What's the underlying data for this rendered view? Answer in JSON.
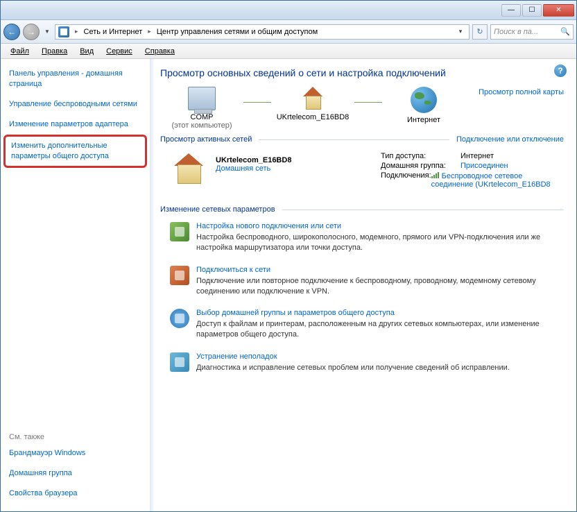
{
  "breadcrumb": {
    "level1": "Сеть и Интернет",
    "level2": "Центр управления сетями и общим доступом"
  },
  "search": {
    "placeholder": "Поиск в па..."
  },
  "menu": {
    "file": "Файл",
    "edit": "Правка",
    "view": "Вид",
    "tools": "Сервис",
    "help": "Справка"
  },
  "sidebar": {
    "home": "Панель управления - домашняя страница",
    "wireless": "Управление беспроводными сетями",
    "adapter": "Изменение параметров адаптера",
    "advanced": "Изменить дополнительные параметры общего доступа",
    "seealso_label": "См. также",
    "firewall": "Брандмауэр Windows",
    "homegroup": "Домашняя группа",
    "browser": "Свойства браузера"
  },
  "content": {
    "heading": "Просмотр основных сведений о сети и настройка подключений",
    "fullmap": "Просмотр полной карты",
    "map": {
      "node1": "COMP",
      "node1_sub": "(этот компьютер)",
      "node2": "UKrtelecom_E16BD8",
      "node3": "Интернет"
    },
    "active_label": "Просмотр активных сетей",
    "connect_link": "Подключение или отключение",
    "network": {
      "name": "UKrtelecom_E16BD8",
      "type": "Домашняя сеть",
      "prop_access_lbl": "Тип доступа:",
      "prop_access_val": "Интернет",
      "prop_homegroup_lbl": "Домашняя группа:",
      "prop_homegroup_val": "Присоединен",
      "prop_conn_lbl": "Подключения:",
      "prop_conn_val": "Беспроводное сетевое соединение (UKrtelecom_E16BD8"
    },
    "change_label": "Изменение сетевых параметров",
    "tasks": [
      {
        "title": "Настройка нового подключения или сети",
        "desc": "Настройка беспроводного, широкополосного, модемного, прямого или VPN-подключения или же настройка маршрутизатора или точки доступа."
      },
      {
        "title": "Подключиться к сети",
        "desc": "Подключение или повторное подключение к беспроводному, проводному, модемному сетевому соединению или подключение к VPN."
      },
      {
        "title": "Выбор домашней группы и параметров общего доступа",
        "desc": "Доступ к файлам и принтерам, расположенным на других сетевых компьютерах, или изменение параметров общего доступа."
      },
      {
        "title": "Устранение неполадок",
        "desc": "Диагностика и исправление сетевых проблем или получение сведений об исправлении."
      }
    ]
  }
}
